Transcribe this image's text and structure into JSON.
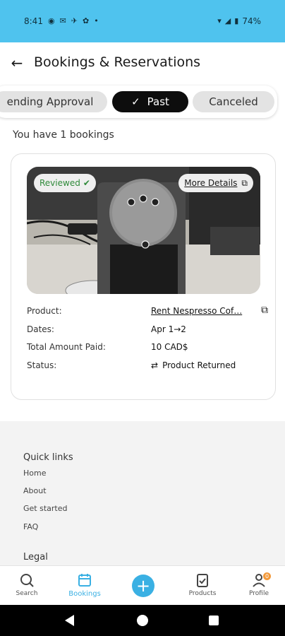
{
  "status_bar": {
    "time": "8:41",
    "battery": "74%",
    "colors": {
      "background": "#4fc3ee"
    }
  },
  "header": {
    "title": "Bookings & Reservations",
    "back_icon": "arrow-left-icon"
  },
  "tabs": [
    {
      "label": "Pending Approval",
      "visible_text": "ending Approval",
      "active": false
    },
    {
      "label": "Past",
      "active": true,
      "icon": "check-icon"
    },
    {
      "label": "Canceled",
      "active": false
    }
  ],
  "bookings_count_text": "You have 1 bookings",
  "booking": {
    "badge_reviewed": "Reviewed",
    "more_details": "More Details",
    "fields": {
      "product_label": "Product:",
      "product_value": "Rent Nespresso Cof…",
      "dates_label": "Dates:",
      "dates_value": "Apr 1→2",
      "amount_label": "Total Amount Paid:",
      "amount_value": "10 CAD$",
      "status_label": "Status:",
      "status_value": "Product Returned"
    }
  },
  "footer": {
    "quick_links_title": "Quick links",
    "links": [
      "Home",
      "About",
      "Get started",
      "FAQ"
    ],
    "legal_title": "Legal"
  },
  "bottom_nav": {
    "search": "Search",
    "bookings": "Bookings",
    "products": "Products",
    "profile": "Profile",
    "profile_badge": "0",
    "accent_color": "#3ab0e3"
  }
}
